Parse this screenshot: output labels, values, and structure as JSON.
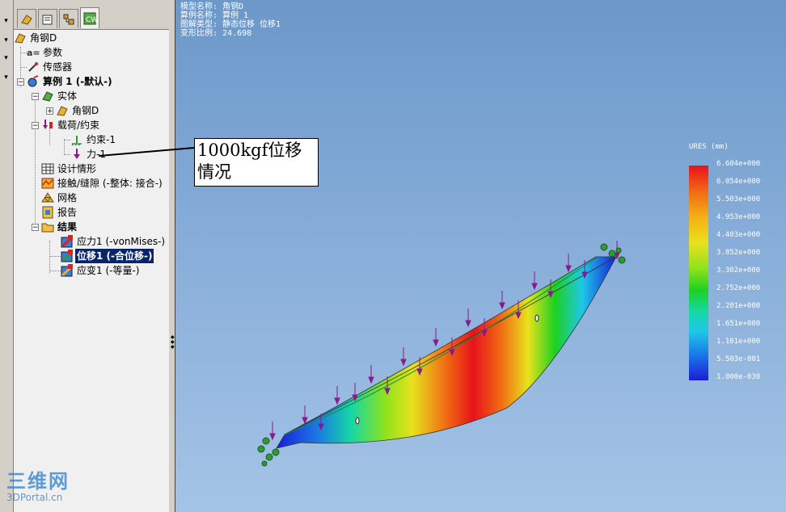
{
  "tree": {
    "root": "角钢D",
    "params": "参数",
    "sensors": "传感器",
    "study": "算例 1 (-默认-)",
    "solids": "实体",
    "solid_item": "角钢D",
    "loads": "载荷/约束",
    "fixture": "约束-1",
    "force": "力-1",
    "design": "设计情形",
    "contact": "接触/缝隙 (-整体: 接合-)",
    "mesh": "网格",
    "report": "报告",
    "results": "结果",
    "stress": "应力1 (-vonMises-)",
    "displacement": "位移1 (-合位移-)",
    "strain": "应变1 (-等量-)"
  },
  "viewport": {
    "info": {
      "model_name": "模型名称: 角钢D",
      "study_name": "算例名称: 算例 1",
      "plot_type": "图解类型: 静态位移 位移1",
      "deform_scale": "变形比例: 24.698"
    },
    "legend": {
      "title": "URES (mm)",
      "values": [
        "6.604e+000",
        "6.054e+000",
        "5.503e+000",
        "4.953e+000",
        "4.403e+000",
        "3.852e+000",
        "3.302e+000",
        "2.752e+000",
        "2.201e+000",
        "1.651e+000",
        "1.101e+000",
        "5.503e-001",
        "1.000e-030"
      ],
      "colors": [
        "#e8131a",
        "#1e5fd8"
      ]
    },
    "callout_line1": "1000kgf位移",
    "callout_line2": "情况"
  },
  "watermark": {
    "big": "三维网",
    "small": "3DPortal.cn"
  },
  "colors": {
    "selection": "#0a246a",
    "force_arrow": "#8a1a8c",
    "fixture": "#2d9a35"
  }
}
